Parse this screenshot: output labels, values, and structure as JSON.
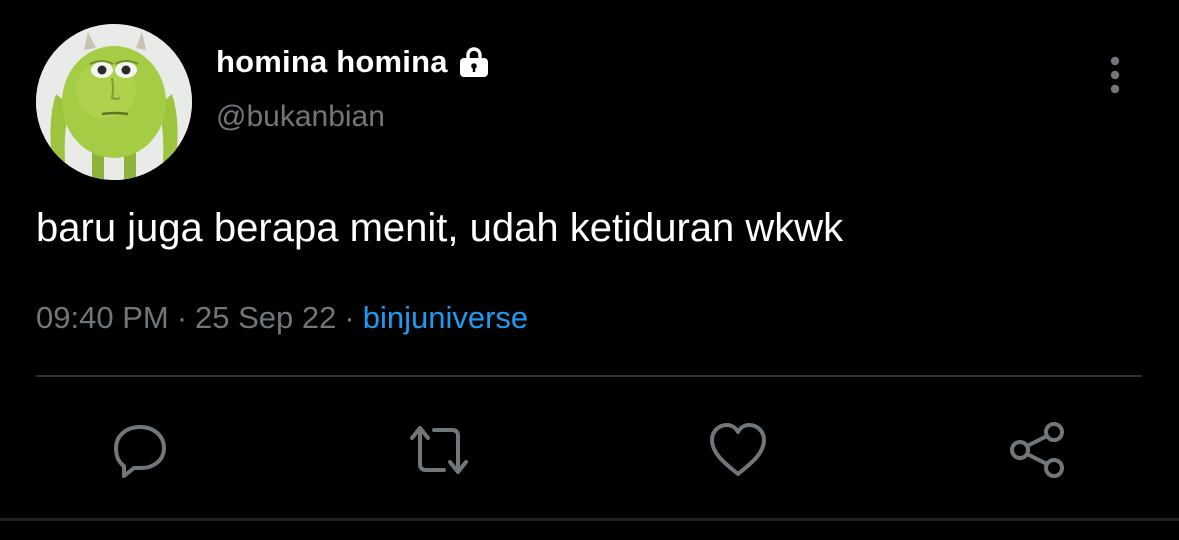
{
  "tweet": {
    "display_name": "homina homina",
    "handle": "@bukanbian",
    "text": "baru juga berapa menit, udah ketiduran wkwk",
    "time": "09:40 PM",
    "separator": "·",
    "date": "25 Sep 22",
    "source": "binjuniverse"
  },
  "icons": {
    "lock": "lock-icon",
    "more": "more-vertical-icon",
    "reply": "reply-icon",
    "retweet": "retweet-icon",
    "like": "heart-icon",
    "share": "share-icon"
  },
  "colors": {
    "background": "#000000",
    "text_primary": "#ffffff",
    "text_secondary": "#71767b",
    "accent": "#1d9bf0",
    "divider": "#2f3336",
    "icon": "#71767b"
  }
}
